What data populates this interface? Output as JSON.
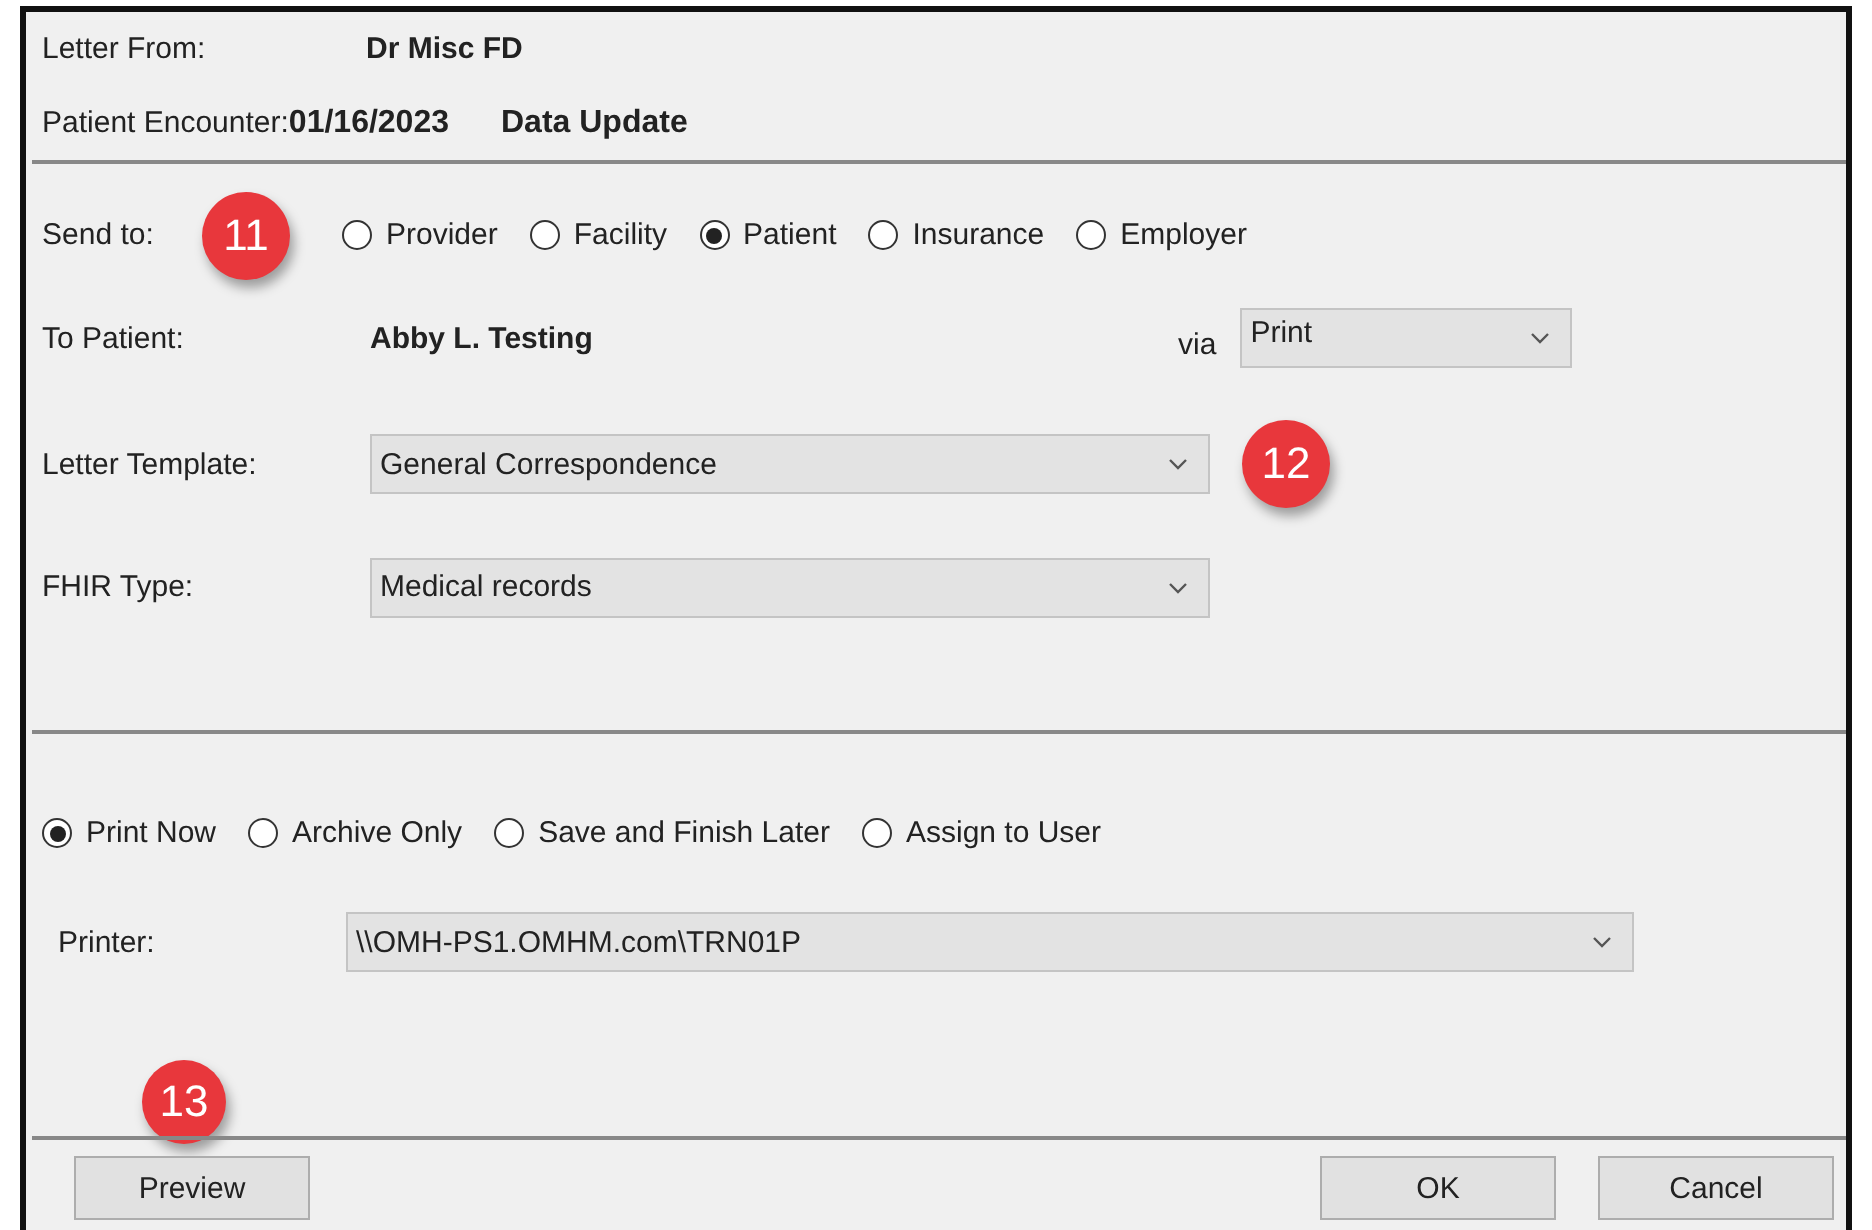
{
  "header": {
    "letter_from_label": "Letter From:",
    "letter_from": "Dr Misc FD",
    "encounter_label": "Patient Encounter:",
    "encounter_date": "01/16/2023",
    "encounter_type": "Data Update"
  },
  "send_to": {
    "label": "Send to:",
    "callout": "11",
    "options": [
      {
        "label": "Provider",
        "selected": false
      },
      {
        "label": "Facility",
        "selected": false
      },
      {
        "label": "Patient",
        "selected": true
      },
      {
        "label": "Insurance",
        "selected": false
      },
      {
        "label": "Employer",
        "selected": false
      }
    ]
  },
  "recipient": {
    "label": "To Patient:",
    "name": "Abby L. Testing",
    "via_label": "via",
    "via": "Print"
  },
  "letter_template": {
    "label": "Letter Template:",
    "value": "General Correspondence",
    "callout": "12"
  },
  "fhir_type": {
    "label": "FHIR Type:",
    "value": "Medical records"
  },
  "actions": [
    {
      "label": "Print Now",
      "selected": true
    },
    {
      "label": "Archive Only",
      "selected": false
    },
    {
      "label": "Save and Finish Later",
      "selected": false
    },
    {
      "label": "Assign to User",
      "selected": false
    }
  ],
  "printer": {
    "label": "Printer:",
    "value": "\\\\OMH-PS1.OMHM.com\\TRN01P"
  },
  "footer_callout": "13",
  "buttons": {
    "left": [
      "Preview"
    ],
    "right": [
      "OK",
      "Cancel"
    ]
  }
}
